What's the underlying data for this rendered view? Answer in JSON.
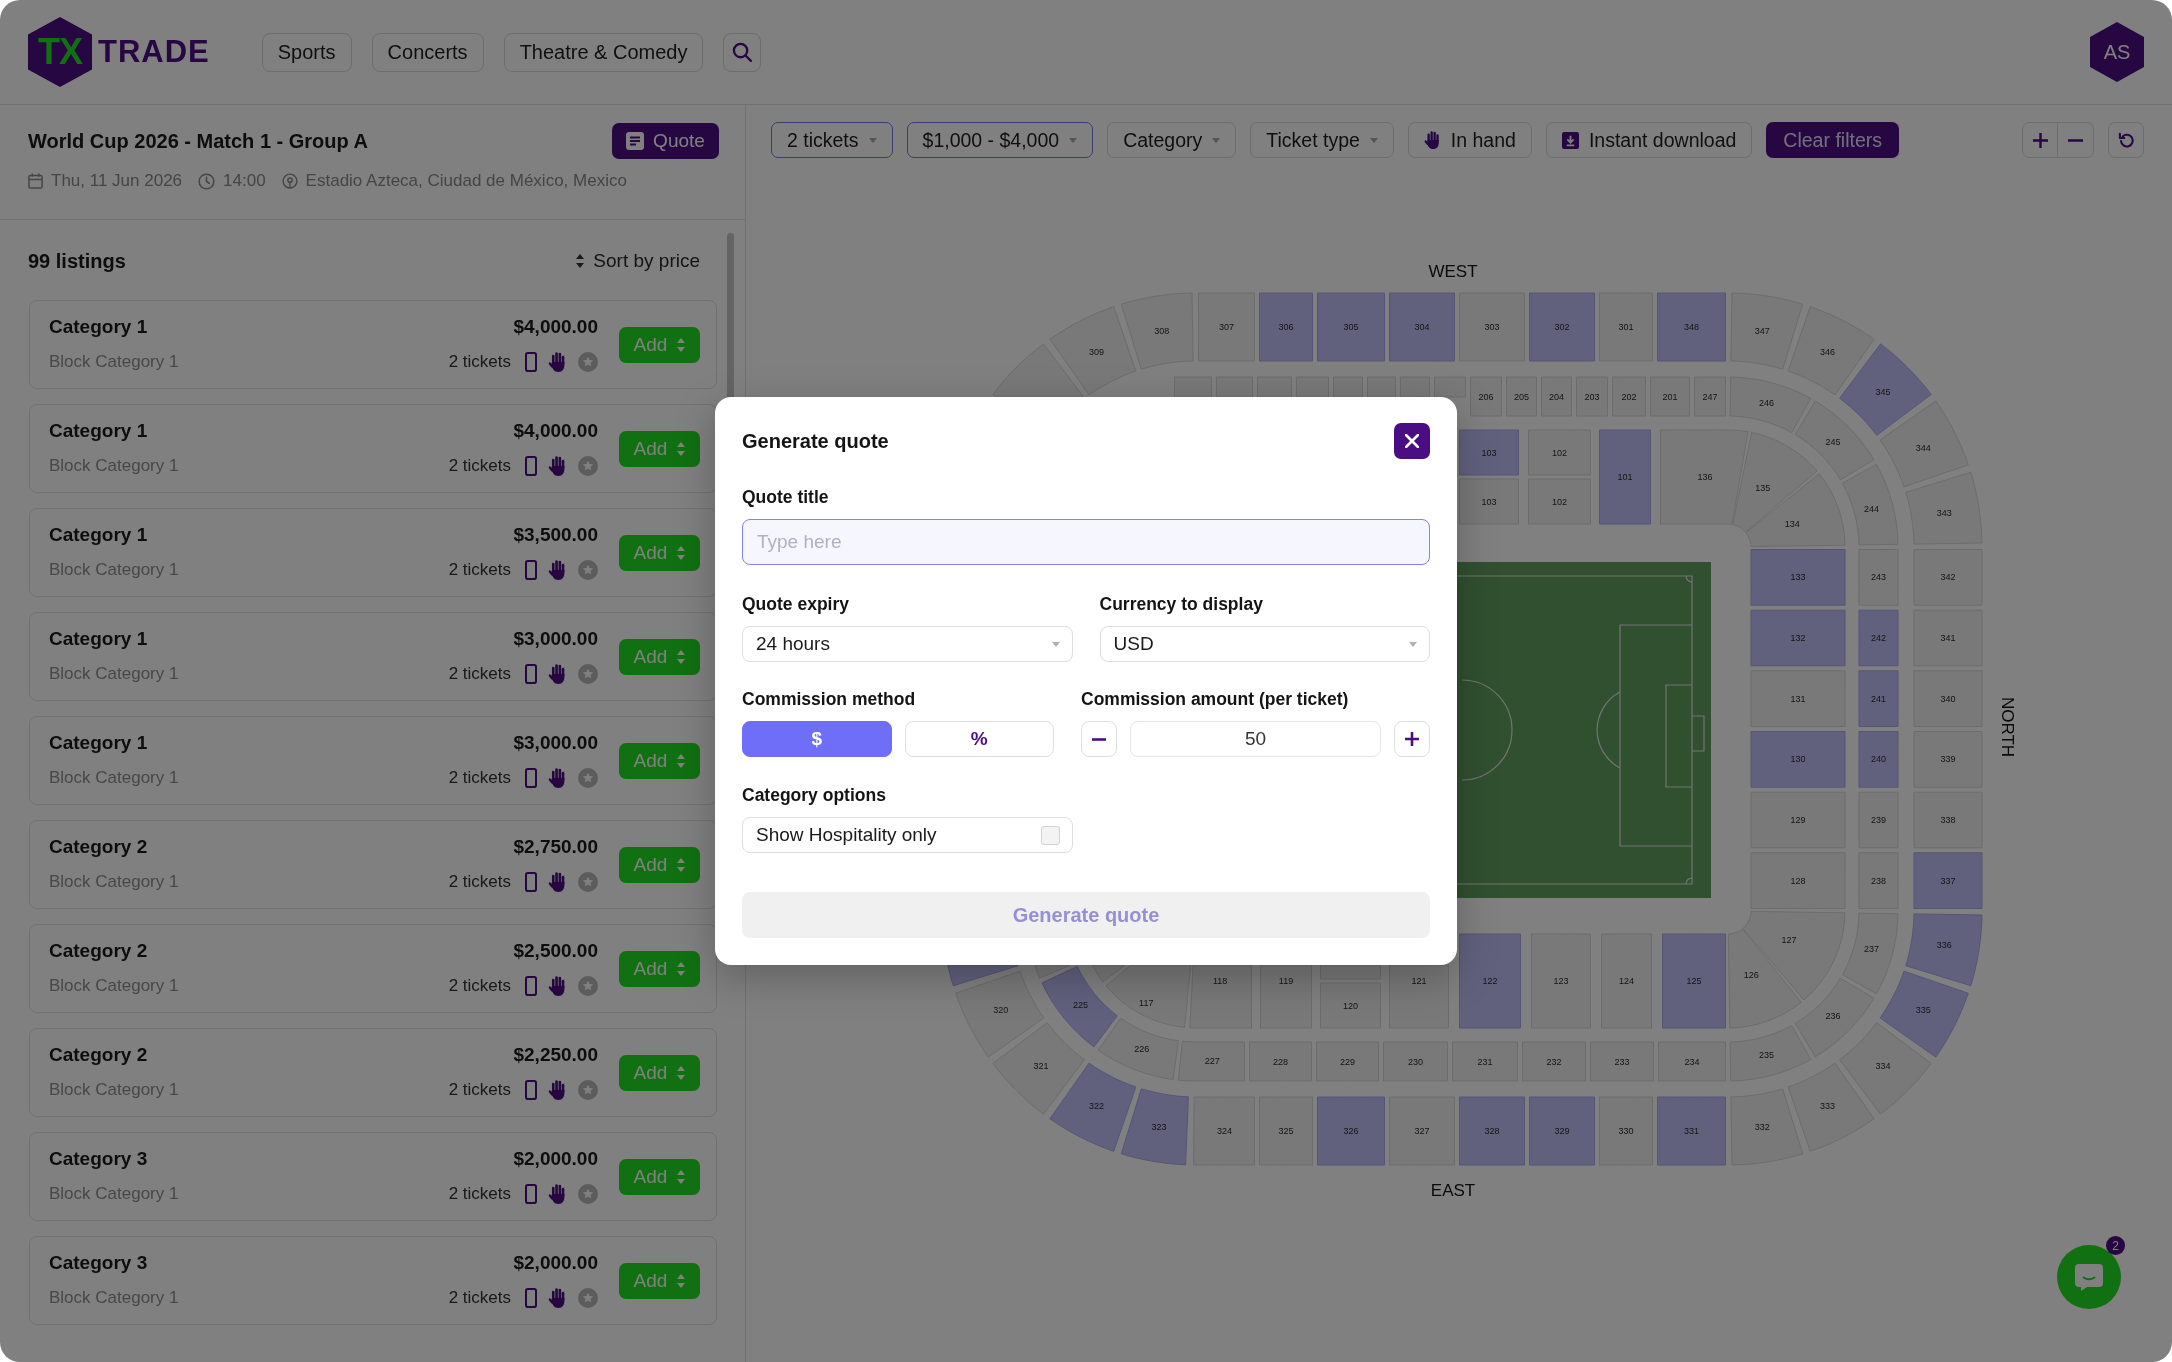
{
  "header": {
    "logo": {
      "mark": "TX",
      "wordmark": "TRADE"
    },
    "nav": [
      "Sports",
      "Concerts",
      "Theatre & Comedy"
    ],
    "avatar": "AS"
  },
  "event": {
    "title": "World Cup 2026 - Match 1 - Group A",
    "quote_button": "Quote",
    "date": "Thu, 11 Jun 2026",
    "time": "14:00",
    "venue": "Estadio Azteca, Ciudad de México, Mexico"
  },
  "listings": {
    "count": "99 listings",
    "sort": "Sort by price",
    "items": [
      {
        "category": "Category 1",
        "block": "Block Category 1",
        "price": "$4,000.00",
        "tickets": "2 tickets",
        "action": "Add"
      },
      {
        "category": "Category 1",
        "block": "Block Category 1",
        "price": "$4,000.00",
        "tickets": "2 tickets",
        "action": "Add"
      },
      {
        "category": "Category 1",
        "block": "Block Category 1",
        "price": "$3,500.00",
        "tickets": "2 tickets",
        "action": "Add"
      },
      {
        "category": "Category 1",
        "block": "Block Category 1",
        "price": "$3,000.00",
        "tickets": "2 tickets",
        "action": "Add"
      },
      {
        "category": "Category 1",
        "block": "Block Category 1",
        "price": "$3,000.00",
        "tickets": "2 tickets",
        "action": "Add"
      },
      {
        "category": "Category 2",
        "block": "Block Category 1",
        "price": "$2,750.00",
        "tickets": "2 tickets",
        "action": "Add"
      },
      {
        "category": "Category 2",
        "block": "Block Category 1",
        "price": "$2,500.00",
        "tickets": "2 tickets",
        "action": "Add"
      },
      {
        "category": "Category 2",
        "block": "Block Category 1",
        "price": "$2,250.00",
        "tickets": "2 tickets",
        "action": "Add"
      },
      {
        "category": "Category 3",
        "block": "Block Category 1",
        "price": "$2,000.00",
        "tickets": "2 tickets",
        "action": "Add"
      },
      {
        "category": "Category 3",
        "block": "Block Category 1",
        "price": "$2,000.00",
        "tickets": "2 tickets",
        "action": "Add"
      }
    ]
  },
  "filters": {
    "items": [
      {
        "kind": "dropdown",
        "label": "2 tickets",
        "active": true
      },
      {
        "kind": "dropdown",
        "label": "$1,000 - $4,000",
        "active": true
      },
      {
        "kind": "dropdown",
        "label": "Category",
        "active": false
      },
      {
        "kind": "dropdown",
        "label": "Ticket type",
        "active": false
      },
      {
        "kind": "toggle",
        "label": "In hand",
        "active": false
      },
      {
        "kind": "toggle",
        "label": "Instant download",
        "active": false
      }
    ],
    "clear": "Clear filters"
  },
  "seat_map": {
    "top_label": "WEST",
    "bottom_label": "EAST",
    "side_label": "NORTH",
    "rings": [
      {
        "top": [
          {
            "available": false
          },
          {
            "label": "309",
            "available": false
          },
          {
            "label": "308",
            "available": false
          },
          {
            "label": "307",
            "available": false
          },
          {
            "label": "306",
            "available": true
          },
          {
            "label": "305",
            "available": true
          },
          {
            "label": "304",
            "available": true
          },
          {
            "label": "303",
            "available": false
          },
          {
            "label": "302",
            "available": true
          },
          {
            "label": "301",
            "available": false
          },
          {
            "label": "348",
            "available": true
          },
          {
            "label": "347",
            "available": false
          },
          {
            "label": "346",
            "available": false
          },
          {
            "label": "345",
            "available": true
          },
          {
            "label": "344",
            "available": false
          },
          {
            "label": "343",
            "available": false
          }
        ],
        "right": [
          {
            "label": "342",
            "available": false
          },
          {
            "label": "341",
            "available": false
          },
          {
            "label": "340",
            "available": false
          },
          {
            "label": "339",
            "available": false
          },
          {
            "label": "338",
            "available": false
          },
          {
            "label": "337",
            "available": true
          }
        ],
        "bottom": [
          {
            "available": true
          },
          {
            "label": "320",
            "available": false
          },
          {
            "label": "321",
            "available": false
          },
          {
            "label": "322",
            "available": true
          },
          {
            "label": "323",
            "available": true
          },
          {
            "label": "324",
            "available": false
          },
          {
            "label": "325",
            "available": false
          },
          {
            "label": "326",
            "available": true
          },
          {
            "label": "327",
            "available": false
          },
          {
            "label": "328",
            "available": true
          },
          {
            "label": "329",
            "available": true
          },
          {
            "label": "330",
            "available": false
          },
          {
            "label": "331",
            "available": true
          },
          {
            "label": "332",
            "available": false
          },
          {
            "label": "333",
            "available": false
          },
          {
            "label": "334",
            "available": false
          },
          {
            "label": "335",
            "available": true
          },
          {
            "label": "336",
            "available": true
          }
        ]
      },
      {
        "top": [
          {
            "available": false
          },
          {
            "available": false
          },
          {
            "available": false
          },
          {
            "available": false
          },
          {
            "available": false
          },
          {
            "available": false
          },
          {
            "available": false
          },
          {
            "available": false
          },
          {
            "label": "206",
            "available": false
          },
          {
            "label": "205",
            "available": false
          },
          {
            "label": "204",
            "available": false
          },
          {
            "label": "203",
            "available": false
          },
          {
            "label": "202",
            "available": false
          },
          {
            "label": "201",
            "available": false
          },
          {
            "label": "247",
            "available": false
          },
          {
            "label": "246",
            "available": false
          },
          {
            "label": "245",
            "available": false
          },
          {
            "label": "244",
            "available": false
          }
        ],
        "right": [
          {
            "label": "243",
            "available": false
          },
          {
            "label": "242",
            "available": true
          },
          {
            "label": "241",
            "available": true
          },
          {
            "label": "240",
            "available": true
          },
          {
            "label": "239",
            "available": false
          },
          {
            "label": "238",
            "available": false
          }
        ],
        "bottom": [
          {
            "available": false
          },
          {
            "label": "225",
            "available": true
          },
          {
            "label": "226",
            "available": false
          },
          {
            "label": "227",
            "available": false
          },
          {
            "label": "228",
            "available": false
          },
          {
            "label": "229",
            "available": false
          },
          {
            "label": "230",
            "available": false
          },
          {
            "label": "231",
            "available": false
          },
          {
            "label": "232",
            "available": false
          },
          {
            "label": "233",
            "available": false
          },
          {
            "label": "234",
            "available": false
          },
          {
            "label": "235",
            "available": false
          },
          {
            "label": "236",
            "available": false
          },
          {
            "label": "237",
            "available": false
          }
        ]
      },
      {
        "top": [
          {
            "label": "103",
            "available": true
          },
          {
            "label": "103",
            "available": false
          },
          {
            "label": "102",
            "available": false
          },
          {
            "label": "102",
            "available": false
          },
          {
            "label": "101",
            "available": true
          },
          {
            "label": "136",
            "available": false
          },
          {
            "label": "135",
            "available": false
          },
          {
            "label": "134",
            "available": false
          }
        ],
        "right": [
          {
            "label": "133",
            "available": true
          },
          {
            "label": "132",
            "available": true
          },
          {
            "label": "131",
            "available": false
          },
          {
            "label": "130",
            "available": true
          },
          {
            "label": "129",
            "available": false
          },
          {
            "label": "128",
            "available": false
          }
        ],
        "bottom": [
          {
            "available": false
          },
          {
            "label": "117",
            "available": false
          },
          {
            "label": "118",
            "available": false
          },
          {
            "label": "119",
            "available": false
          },
          {
            "available": false
          },
          {
            "label": "120",
            "available": false
          },
          {
            "label": "121",
            "available": false
          },
          {
            "label": "122",
            "available": true
          },
          {
            "label": "123",
            "available": false
          },
          {
            "label": "124",
            "available": false
          },
          {
            "label": "125",
            "available": true
          },
          {
            "label": "126",
            "available": false
          },
          {
            "label": "127",
            "available": false
          }
        ]
      }
    ]
  },
  "modal": {
    "title": "Generate quote",
    "quote_title": {
      "label": "Quote title",
      "placeholder": "Type here",
      "focused": true
    },
    "quote_expiry": {
      "label": "Quote expiry",
      "value": "24 hours"
    },
    "currency": {
      "label": "Currency to display",
      "value": "USD"
    },
    "commission_method": {
      "label": "Commission method",
      "options": [
        {
          "label": "$",
          "selected": true
        },
        {
          "label": "%",
          "selected": false
        }
      ]
    },
    "commission_amount": {
      "label": "Commission amount (per ticket)",
      "value": "50"
    },
    "category_options": {
      "label": "Category options",
      "option": {
        "label": "Show Hospitality only",
        "checked": false
      }
    },
    "submit": {
      "label": "Generate quote",
      "disabled": true
    }
  },
  "chat": {
    "badge": "2"
  }
}
